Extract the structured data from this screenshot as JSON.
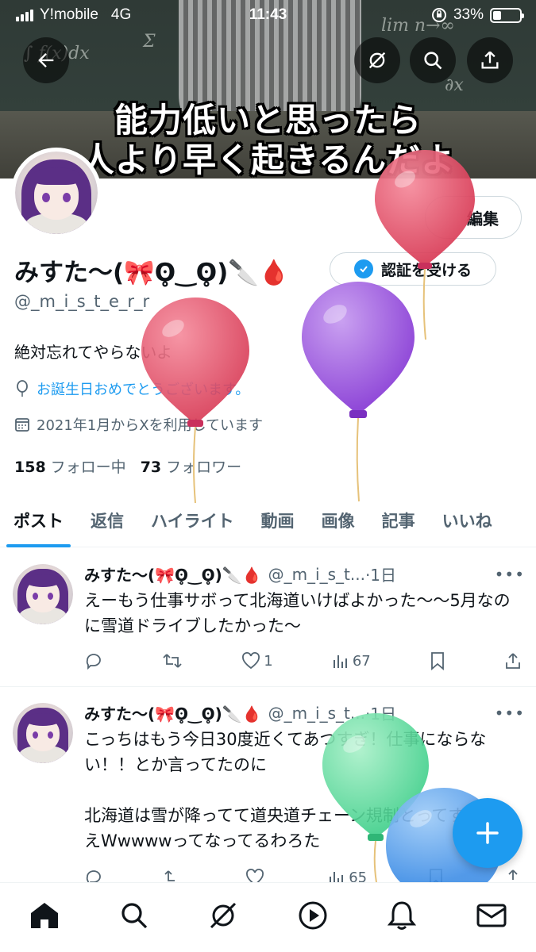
{
  "status_bar": {
    "carrier": "Y!mobile",
    "network": "4G",
    "time": "11:43",
    "battery": "33%"
  },
  "banner": {
    "caption_line1": "能力低いと思ったら",
    "caption_line2": "人より早く起きるんだよ"
  },
  "profile": {
    "edit_label": "編集",
    "display_name": "みすた〜(🎀ʘ̥‿ʘ̥)🔪🩸",
    "verify_label": "認証を受ける",
    "handle": "@_m_i_s_t_e_r_r",
    "bio": "絶対忘れてやらないよ",
    "birthday_text": "お誕生日おめでとうございます。",
    "joined_text": "2021年1月からXを利用しています",
    "following_count": "158",
    "following_label": "フォロー中",
    "followers_count": "73",
    "followers_label": "フォロワー"
  },
  "tabs": [
    {
      "label": "ポスト"
    },
    {
      "label": "返信"
    },
    {
      "label": "ハイライト"
    },
    {
      "label": "動画"
    },
    {
      "label": "画像"
    },
    {
      "label": "記事"
    },
    {
      "label": "いいね"
    }
  ],
  "tweets": [
    {
      "name": "みすた〜(🎀ʘ̥‿ʘ̥)🔪🩸",
      "handle": "@_m_i_s_t...",
      "time": "·1日",
      "text": "えーもう仕事サボって北海道いけばよかった〜〜5月なのに雪道ドライブしたかった〜",
      "likes": "1",
      "views": "67"
    },
    {
      "name": "みすた〜(🎀ʘ̥‿ʘ̥)🔪🩸",
      "handle": "@_m_i_s_t...",
      "time": "·1日",
      "text": "こっちはもう今日30度近くてあつすぎ！仕事にならない！！とか言ってたのに\n\n北海道は雪が降ってて道央道チェーン規制とってすげえええWwwwwってなってるわろた",
      "likes": "",
      "views": "65"
    }
  ],
  "colors": {
    "accent": "#1d9bf0",
    "text": "#0f1419",
    "muted": "#536471"
  },
  "icons": [
    "back-arrow-icon",
    "grok-icon",
    "search-icon",
    "share-icon",
    "location-icon",
    "calendar-icon",
    "reply-icon",
    "retweet-icon",
    "like-icon",
    "views-icon",
    "bookmark-icon",
    "plus-icon",
    "home-icon",
    "play-icon",
    "bell-icon",
    "mail-icon"
  ]
}
